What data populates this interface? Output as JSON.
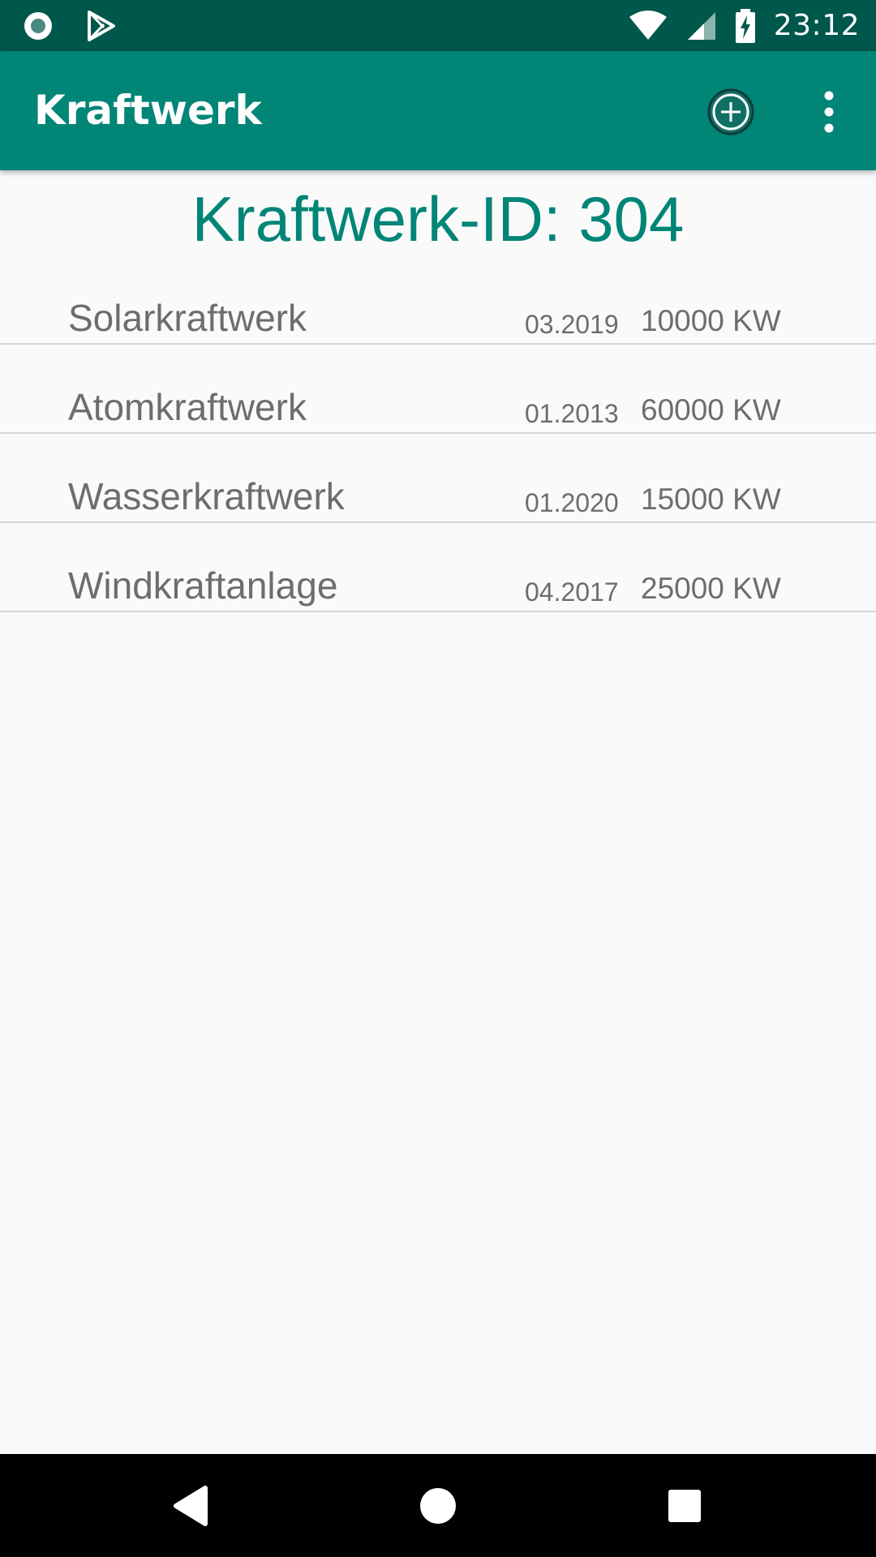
{
  "status_bar": {
    "time": "23:12",
    "icons": [
      "record-icon",
      "play-store-icon",
      "wifi-icon",
      "signal-icon",
      "battery-charging-icon"
    ]
  },
  "app_bar": {
    "title": "Kraftwerk",
    "actions": [
      "add-circle-icon",
      "more-vert-icon"
    ]
  },
  "main": {
    "title": "Kraftwerk-ID: 304",
    "plants": [
      {
        "name": "Solarkraftwerk",
        "date": "03.2019",
        "power": "10000 KW"
      },
      {
        "name": "Atomkraftwerk",
        "date": "01.2013",
        "power": "60000 KW"
      },
      {
        "name": "Wasserkraftwerk",
        "date": "01.2020",
        "power": "15000 KW"
      },
      {
        "name": "Windkraftanlage",
        "date": "04.2017",
        "power": "25000 KW"
      }
    ]
  },
  "nav_bar": {
    "buttons": [
      "back-icon",
      "home-icon",
      "recents-icon"
    ]
  },
  "colors": {
    "primary": "#008577",
    "primary_dark": "#00574b",
    "background": "#fafafa",
    "text_secondary": "#6d6d6d"
  }
}
